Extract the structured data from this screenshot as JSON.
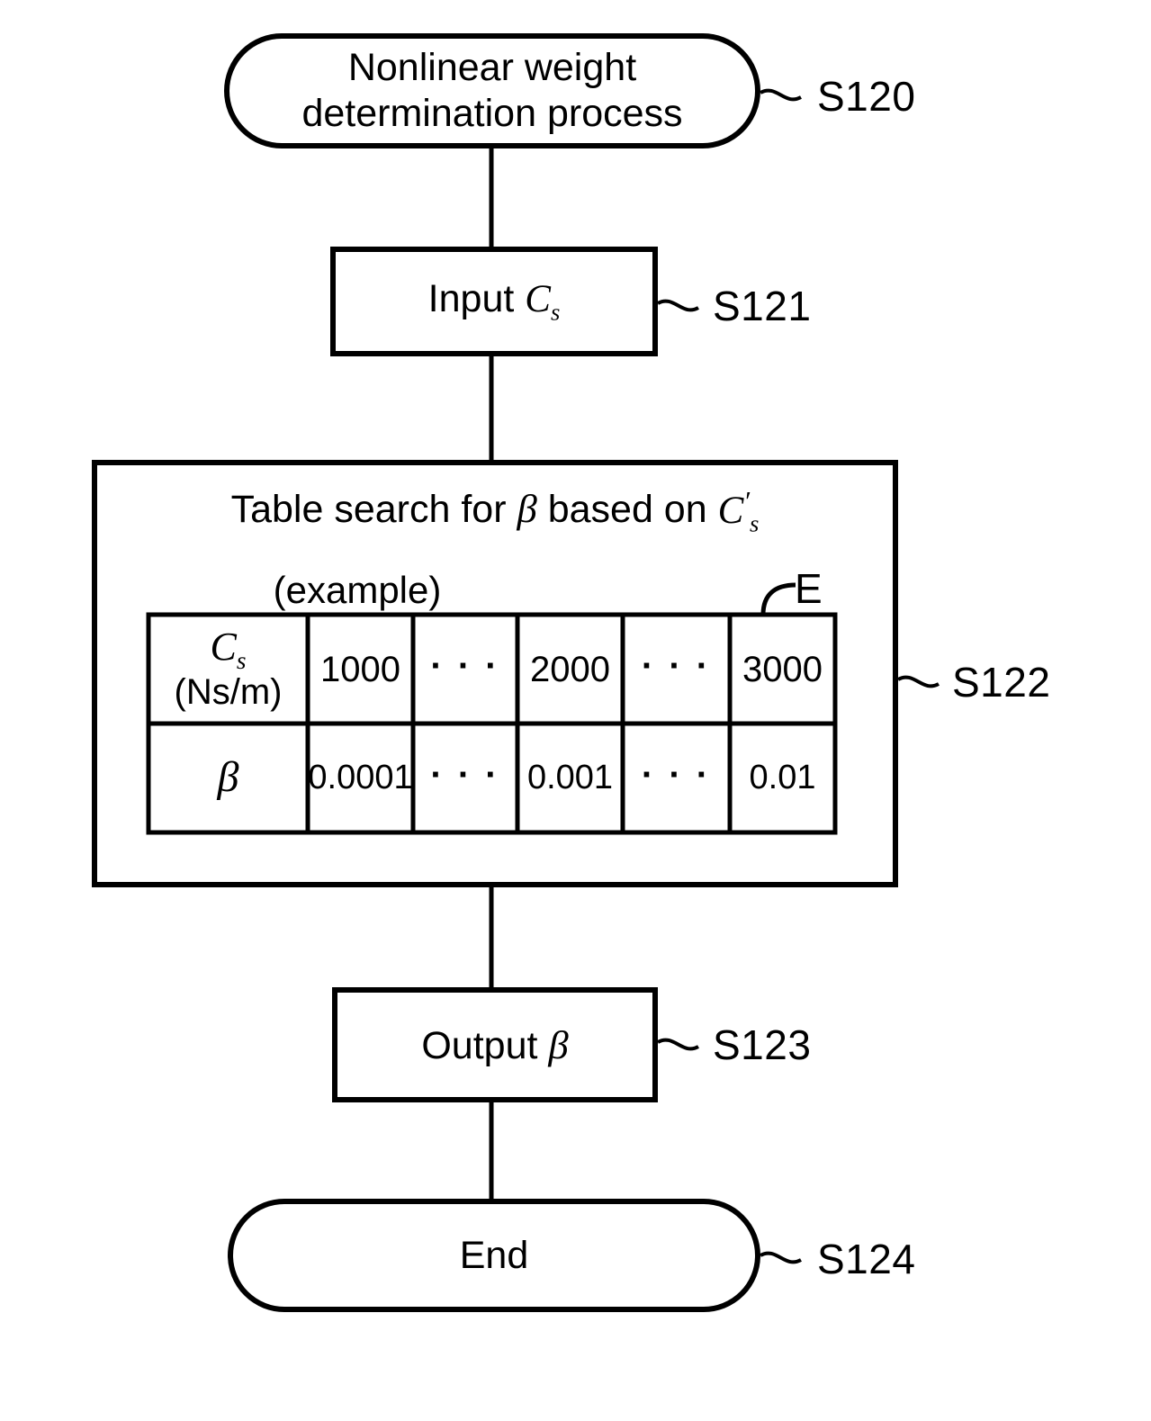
{
  "figure": {
    "kind": "flowchart",
    "title_node": {
      "label": "Nonlinear weight\ndetermination process",
      "step": "S120",
      "shape": "stadium"
    },
    "nodes": [
      {
        "id": "input",
        "label_prefix": "Input ",
        "var": "C",
        "var_sub": "s",
        "step": "S121",
        "shape": "rect"
      },
      {
        "id": "table-search",
        "heading_prefix": "Table search for ",
        "heading_symbol": "β",
        "heading_mid": " based on ",
        "heading_var": "C",
        "heading_var_prime": "′",
        "heading_var_sub": "s",
        "example_note": "(example)",
        "table_ref": "E",
        "step": "S122",
        "shape": "rect"
      },
      {
        "id": "output",
        "label_prefix": "Output ",
        "symbol": "β",
        "step": "S123",
        "shape": "rect"
      },
      {
        "id": "end",
        "label": "End",
        "step": "S124",
        "shape": "stadium"
      }
    ],
    "lookup_table": {
      "ref": "E",
      "row_headers": [
        {
          "var": "C",
          "sub": "s",
          "unit": "(Ns/m)"
        },
        {
          "var": "β",
          "sub": "",
          "unit": ""
        }
      ],
      "columns": [
        "1000",
        "· · ·",
        "2000",
        "· · ·",
        "3000"
      ],
      "rows": [
        {
          "header_symbol": "C",
          "header_sub": "s",
          "header_unit": "(Ns/m)",
          "values": [
            "1000",
            "· · ·",
            "2000",
            "· · ·",
            "3000"
          ]
        },
        {
          "header_symbol": "β",
          "header_sub": "",
          "header_unit": "",
          "values": [
            "0.0001",
            "· · ·",
            "0.001",
            "· · ·",
            "0.01"
          ]
        }
      ]
    },
    "colors": {
      "line": "#000000",
      "background": "#ffffff",
      "text": "#000000"
    }
  }
}
